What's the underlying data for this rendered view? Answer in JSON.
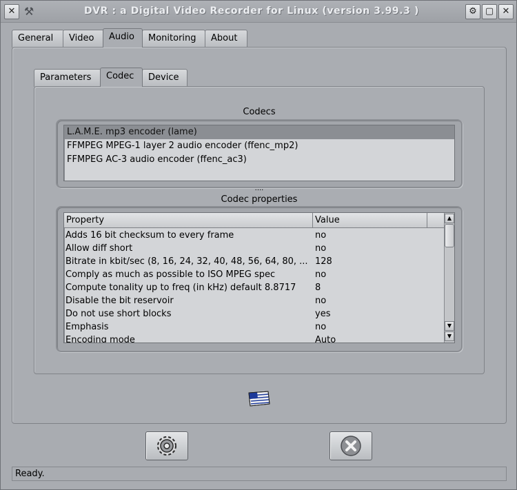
{
  "window": {
    "title": "DVR : a Digital Video Recorder for Linux (version 3.99.3 )",
    "close_glyph": "✕",
    "tool_glyph": "⚒",
    "buttons": [
      {
        "name": "refresh-icon",
        "glyph": "⚙"
      },
      {
        "name": "minimize-icon",
        "glyph": "▢"
      },
      {
        "name": "close-icon",
        "glyph": "✕"
      }
    ]
  },
  "main_tabs": [
    {
      "label": "General",
      "active": false
    },
    {
      "label": "Video",
      "active": false
    },
    {
      "label": "Audio",
      "active": true
    },
    {
      "label": "Monitoring",
      "active": false
    },
    {
      "label": "About",
      "active": false
    }
  ],
  "audio_tabs": [
    {
      "label": "Parameters",
      "active": false
    },
    {
      "label": "Codec",
      "active": true
    },
    {
      "label": "Device",
      "active": false
    }
  ],
  "codecs": {
    "title": "Codecs",
    "items": [
      {
        "label": "L.A.M.E. mp3 encoder (lame)",
        "selected": true
      },
      {
        "label": "FFMPEG MPEG-1 layer 2 audio encoder (ffenc_mp2)",
        "selected": false
      },
      {
        "label": "FFMPEG AC-3 audio encoder (ffenc_ac3)",
        "selected": false
      }
    ]
  },
  "splitter_handle": "....",
  "codec_properties": {
    "title": "Codec properties",
    "columns": [
      "Property",
      "Value"
    ],
    "rows": [
      {
        "property": "Adds 16 bit checksum to every frame",
        "value": "no"
      },
      {
        "property": "Allow diff short",
        "value": "no"
      },
      {
        "property": "Bitrate in kbit/sec (8, 16, 24, 32, 40, 48, 56, 64, 80, ...",
        "value": "128"
      },
      {
        "property": "Comply as much as possible to ISO MPEG spec",
        "value": "no"
      },
      {
        "property": "Compute tonality up to freq (in kHz) default 8.8717",
        "value": "8"
      },
      {
        "property": "Disable the bit reservoir",
        "value": "no"
      },
      {
        "property": "Do not use short blocks",
        "value": "yes"
      },
      {
        "property": "Emphasis",
        "value": "no"
      },
      {
        "property": "Encoding mode",
        "value": "Auto"
      }
    ]
  },
  "status": {
    "text": "Ready."
  }
}
